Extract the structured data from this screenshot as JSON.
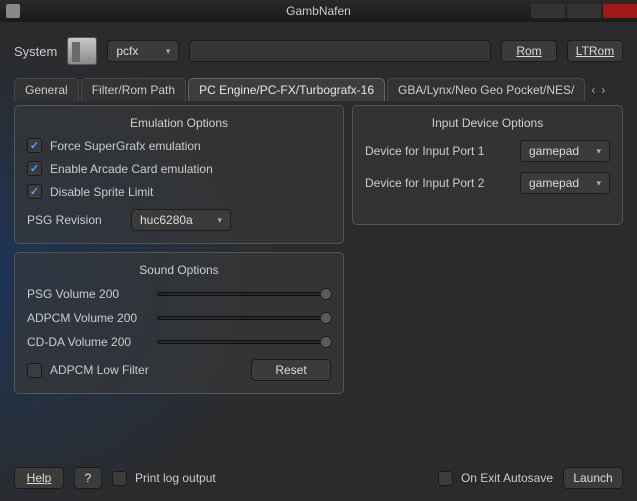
{
  "window": {
    "title": "GambNafen"
  },
  "toolbar": {
    "system_label": "System",
    "system_combo": "pcfx",
    "rom_btn": "Rom",
    "ltrom_btn": "LTRom"
  },
  "tabs": {
    "items": [
      {
        "label": "General"
      },
      {
        "label": "Filter/Rom Path"
      },
      {
        "label": "PC Engine/PC-FX/Turbografx-16"
      },
      {
        "label": "GBA/Lynx/Neo Geo Pocket/NES/"
      }
    ],
    "active_index": 2
  },
  "emulation": {
    "title": "Emulation Options",
    "force_sgx": "Force SuperGrafx emulation",
    "arcade_card": "Enable Arcade Card emulation",
    "disable_sprite": "Disable Sprite Limit",
    "psg_rev_label": "PSG Revision",
    "psg_rev_value": "huc6280a"
  },
  "sound": {
    "title": "Sound Options",
    "psg_label": "PSG Volume 200",
    "adpcm_label": "ADPCM Volume 200",
    "cdda_label": "CD-DA Volume 200",
    "adpcm_low": "ADPCM Low Filter",
    "reset": "Reset"
  },
  "input": {
    "title": "Input Device Options",
    "port1_label": "Device for Input Port 1",
    "port1_value": "gamepad",
    "port2_label": "Device for Input Port 2",
    "port2_value": "gamepad"
  },
  "footer": {
    "help": "Help",
    "question": "?",
    "print_log": "Print log output",
    "autosave": "On Exit Autosave",
    "launch": "Launch"
  }
}
